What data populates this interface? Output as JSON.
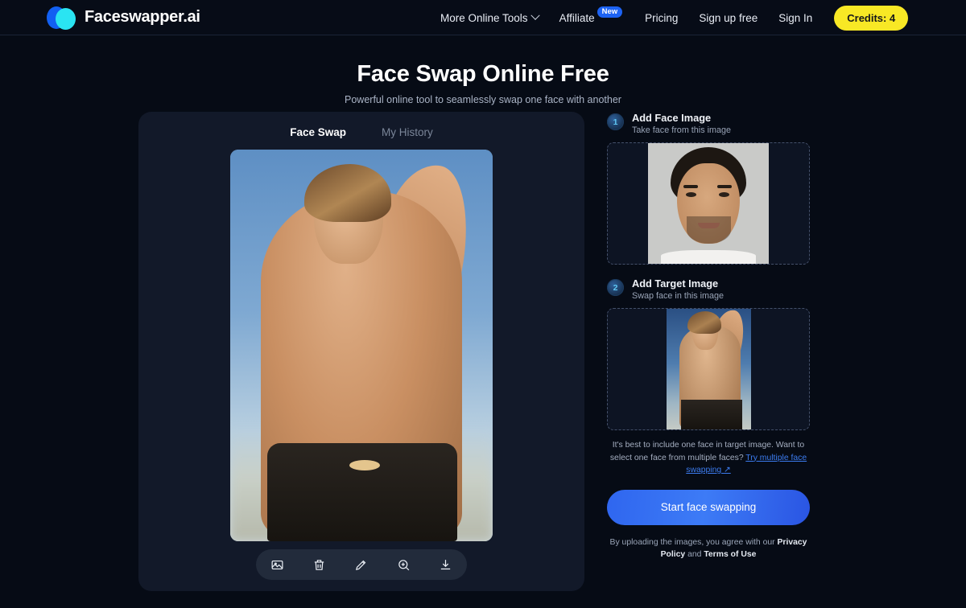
{
  "header": {
    "brand_name": "Faceswapper.ai",
    "logo_icon": "two-overlapping-ovals-logo",
    "logo_color_back": "#1260f2",
    "logo_color_front": "#2ae4f2",
    "nav": [
      {
        "label": "More Online Tools",
        "icon": "chevron-down-icon",
        "has_chevron": true,
        "badge": ""
      },
      {
        "label": "Affiliate",
        "has_chevron": false,
        "badge": "New"
      },
      {
        "label": "Pricing",
        "has_chevron": false,
        "badge": ""
      },
      {
        "label": "Sign up free",
        "has_chevron": false,
        "badge": ""
      },
      {
        "label": "Sign In",
        "has_chevron": false,
        "badge": ""
      }
    ],
    "credits_label": "Credits: 4",
    "credits_color": "#f8e825",
    "badge_color": "#1d63f3"
  },
  "hero": {
    "title": "Face Swap Online Free",
    "subtitle": "Powerful online tool to seamlessly swap one face with another"
  },
  "card": {
    "tabs": [
      {
        "label": "Face Swap",
        "active": true
      },
      {
        "label": "My History",
        "active": false
      }
    ],
    "preview_alt": "face-swapped result photo of a shirtless muscular man with hand behind head against blue sky",
    "toolbar": [
      {
        "name": "image-icon",
        "label": "Change image"
      },
      {
        "name": "trash-icon",
        "label": "Delete"
      },
      {
        "name": "pencil-icon",
        "label": "Edit"
      },
      {
        "name": "zoom-in-icon",
        "label": "Zoom in"
      },
      {
        "name": "download-icon",
        "label": "Download"
      }
    ]
  },
  "panel": {
    "step1": {
      "number": "1",
      "title": "Add Face Image",
      "subtitle": "Take face from this image",
      "image_alt": "portrait photo of a man with short dark hair and beard on a gray background"
    },
    "step2": {
      "number": "2",
      "title": "Add Target Image",
      "subtitle": "Swap face in this image",
      "image_alt": "photo of a shirtless muscular man with blond hair against blue sky"
    },
    "hint_text": "It's best to include one face in target image. Want to select one face from multiple faces? ",
    "hint_link": "Try multiple face swapping ↗",
    "cta_label": "Start face swapping",
    "cta_color": "#2f66ef",
    "legal_prefix": "By uploading the images, you agree with our ",
    "legal_privacy": "Privacy Policy",
    "legal_middle": " and ",
    "legal_terms": "Terms of Use"
  }
}
